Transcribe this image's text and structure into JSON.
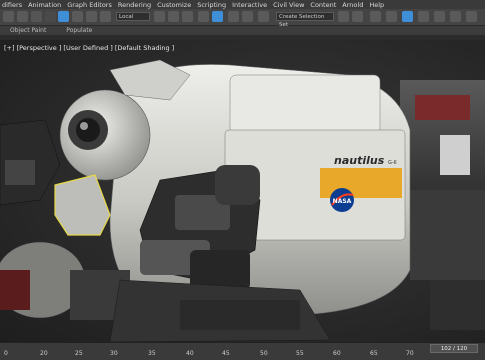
{
  "menu": [
    "difiers",
    "Animation",
    "Graph Editors",
    "Rendering",
    "Customize",
    "Scripting",
    "Interactive",
    "Civil View",
    "Content",
    "Arnold",
    "Help"
  ],
  "toolbar": {
    "coord_system": "Local",
    "selection_set": "Create Selection Set"
  },
  "ribbon": {
    "object_paint": "Object Paint",
    "populate": "Populate"
  },
  "viewport": {
    "label": "[+] [Perspective ] [User Defined ] [Default Shading ]"
  },
  "model": {
    "nameplate": "nautilus",
    "nameplate_suffix": "G-II",
    "logo": "NASA"
  },
  "timeline": {
    "ticks": [
      "0",
      "20",
      "25",
      "30",
      "35",
      "40",
      "45",
      "50",
      "55",
      "60",
      "65",
      "70"
    ],
    "frame_counter": "102 / 120"
  },
  "colors": {
    "accent": "#3f8fd8",
    "stripe": "#e8a92a",
    "hull": "#d7d7d3"
  }
}
